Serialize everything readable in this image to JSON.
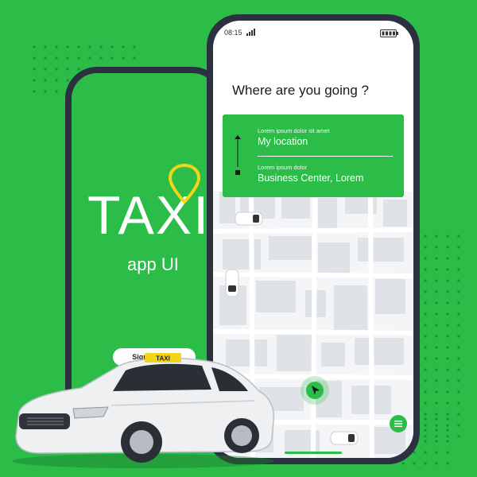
{
  "back_phone": {
    "logo_text": "TAXI",
    "subtitle": "app UI",
    "signup_label": "Sign Up Now"
  },
  "front_phone": {
    "status_time": "08:15",
    "question": "Where are you going ?",
    "from": {
      "caption": "Lorem ipsum dolor sit amet",
      "value": "My location"
    },
    "to": {
      "caption": "Lorem ipsum dolor",
      "value": "Business Center, Lorem"
    }
  },
  "car": {
    "roof_sign": "TAXI"
  },
  "colors": {
    "brand_green": "#2bbd47",
    "pin_yellow": "#f2d41b",
    "phone_frame": "#2b3140"
  },
  "icons": [
    "map-pin-icon",
    "signal-icon",
    "battery-icon",
    "route-icon",
    "navigation-arrow-icon",
    "menu-icon"
  ]
}
